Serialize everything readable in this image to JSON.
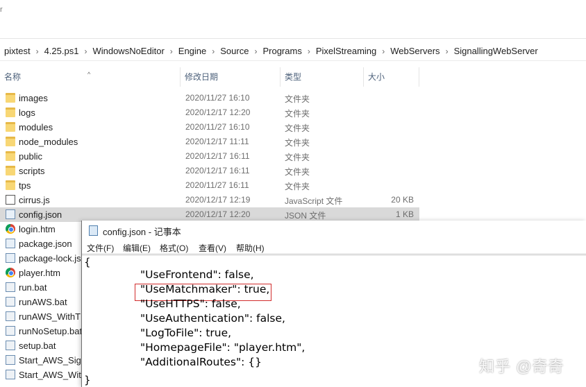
{
  "ribbon": {
    "fragment": "r"
  },
  "breadcrumb": [
    "pixtest",
    "4.25.ps1",
    "WindowsNoEditor",
    "Engine",
    "Source",
    "Programs",
    "PixelStreaming",
    "WebServers",
    "SignallingWebServer"
  ],
  "columns": {
    "name": "名称",
    "modified": "修改日期",
    "type": "类型",
    "size": "大小"
  },
  "files": [
    {
      "name": "images",
      "date": "2020/11/27 16:10",
      "type": "文件夹",
      "size": "",
      "icon": "folder-icon"
    },
    {
      "name": "logs",
      "date": "2020/12/17 12:20",
      "type": "文件夹",
      "size": "",
      "icon": "folder-icon"
    },
    {
      "name": "modules",
      "date": "2020/11/27 16:10",
      "type": "文件夹",
      "size": "",
      "icon": "folder-icon"
    },
    {
      "name": "node_modules",
      "date": "2020/12/17 11:11",
      "type": "文件夹",
      "size": "",
      "icon": "folder-icon"
    },
    {
      "name": "public",
      "date": "2020/12/17 16:11",
      "type": "文件夹",
      "size": "",
      "icon": "folder-icon"
    },
    {
      "name": "scripts",
      "date": "2020/12/17 16:11",
      "type": "文件夹",
      "size": "",
      "icon": "folder-icon"
    },
    {
      "name": "tps",
      "date": "2020/11/27 16:11",
      "type": "文件夹",
      "size": "",
      "icon": "folder-icon"
    },
    {
      "name": "cirrus.js",
      "date": "2020/12/17 12:19",
      "type": "JavaScript 文件",
      "size": "20 KB",
      "icon": "js-file-icon"
    },
    {
      "name": "config.json",
      "date": "2020/12/17 12:20",
      "type": "JSON 文件",
      "size": "1 KB",
      "icon": "json-file-icon",
      "selected": true
    },
    {
      "name": "login.htm",
      "date": "",
      "type": "",
      "size": "",
      "icon": "chrome-icon"
    },
    {
      "name": "package.json",
      "date": "",
      "type": "",
      "size": "",
      "icon": "json-file-icon"
    },
    {
      "name": "package-lock.js",
      "date": "",
      "type": "",
      "size": "",
      "icon": "json-file-icon"
    },
    {
      "name": "player.htm",
      "date": "",
      "type": "",
      "size": "",
      "icon": "chrome-icon"
    },
    {
      "name": "run.bat",
      "date": "",
      "type": "",
      "size": "",
      "icon": "bat-file-icon"
    },
    {
      "name": "runAWS.bat",
      "date": "",
      "type": "",
      "size": "",
      "icon": "bat-file-icon"
    },
    {
      "name": "runAWS_WithTU",
      "date": "",
      "type": "",
      "size": "",
      "icon": "bat-file-icon"
    },
    {
      "name": "runNoSetup.bat",
      "date": "",
      "type": "",
      "size": "",
      "icon": "bat-file-icon"
    },
    {
      "name": "setup.bat",
      "date": "",
      "type": "",
      "size": "",
      "icon": "bat-file-icon"
    },
    {
      "name": "Start_AWS_Sign",
      "date": "",
      "type": "",
      "size": "",
      "icon": "bat-file-icon"
    },
    {
      "name": "Start_AWS_With",
      "date": "",
      "type": "",
      "size": "",
      "icon": "bat-file-icon"
    }
  ],
  "notepad": {
    "title": "config.json - 记事本",
    "menu": [
      "文件(F)",
      "编辑(E)",
      "格式(O)",
      "查看(V)",
      "帮助(H)"
    ],
    "open_brace": "{",
    "close_brace": "}",
    "lines": [
      "\"UseFrontend\": false,",
      "\"UseMatchmaker\": true,",
      "\"UseHTTPS\": false,",
      "\"UseAuthentication\": false,",
      "\"LogToFile\": true,",
      "\"HomepageFile\": \"player.htm\",",
      "\"AdditionalRoutes\": {}"
    ],
    "highlight_color": "#d12b2b"
  },
  "watermark": "知乎 @奇奇"
}
